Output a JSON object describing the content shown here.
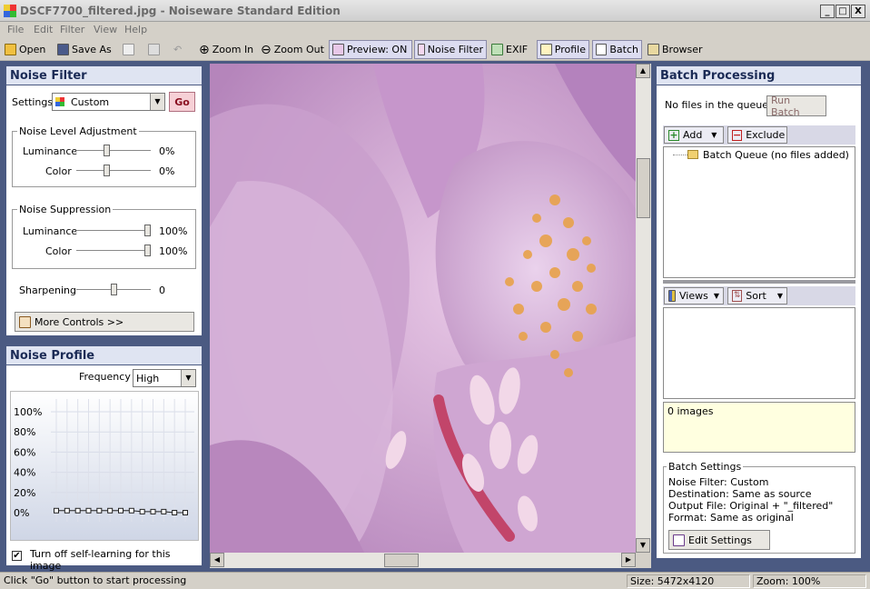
{
  "window": {
    "title": "DSCF7700_filtered.jpg - Noiseware Standard Edition",
    "min": "_",
    "max": "□",
    "close": "X"
  },
  "menu": [
    "File",
    "Edit",
    "Filter",
    "View",
    "Help"
  ],
  "toolbar": {
    "open": "Open",
    "save_as": "Save As",
    "zoom_in": "Zoom In",
    "zoom_out": "Zoom Out",
    "preview": "Preview: ON",
    "noise_filter": "Noise Filter",
    "exif": "EXIF",
    "profile": "Profile",
    "batch": "Batch",
    "browser": "Browser"
  },
  "noise_filter": {
    "title": "Noise Filter",
    "settings_label": "Settings",
    "settings_value": "Custom",
    "go": "Go",
    "level_group": "Noise Level Adjustment",
    "level": {
      "lum_label": "Luminance",
      "lum_value": "0%",
      "lum_level": 0.4,
      "col_label": "Color",
      "col_value": "0%",
      "col_level": 0.4
    },
    "supp_group": "Noise Suppression",
    "supp": {
      "lum_label": "Luminance",
      "lum_value": "100%",
      "lum_level": 1.0,
      "col_label": "Color",
      "col_value": "100%",
      "col_level": 1.0
    },
    "sharp_label": "Sharpening",
    "sharp_value": "0",
    "sharp_level": 0.5,
    "more": "More Controls >>"
  },
  "noise_profile": {
    "title": "Noise Profile",
    "freq_label": "Frequency",
    "freq_value": "High",
    "yticks": [
      "100%",
      "80%",
      "60%",
      "40%",
      "20%",
      "0%"
    ],
    "points": [
      0.02,
      0.02,
      0.02,
      0.02,
      0.02,
      0.02,
      0.02,
      0.02,
      0.01,
      0.01,
      0.01,
      0.0,
      0.0
    ],
    "checkbox": "Turn off self-learning for this image",
    "checked": true
  },
  "batch": {
    "title": "Batch Processing",
    "queue_status": "No files in the queue",
    "run": "Run Batch",
    "add": "Add",
    "exclude": "Exclude",
    "queue_item": "Batch Queue (no files added)",
    "views": "Views",
    "sort": "Sort",
    "images": "0 images",
    "settings_group": "Batch Settings",
    "settings": [
      "Noise Filter: Custom",
      "Destination: Same as source",
      "Output File: Original + \"_filtered\"",
      "Format: Same as original"
    ],
    "edit": "Edit Settings"
  },
  "status": {
    "hint": "Click \"Go\" button to start processing",
    "size": "Size: 5472x4120",
    "zoom": "Zoom: 100%"
  }
}
